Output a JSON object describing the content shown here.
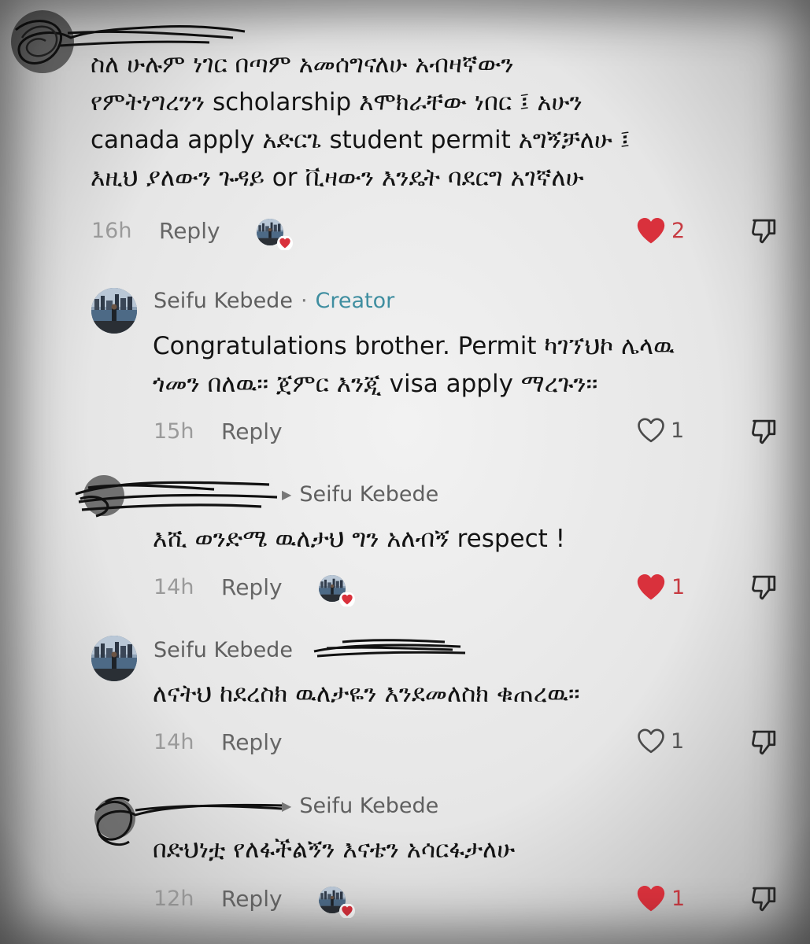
{
  "colors": {
    "liked_heart": "#d9313c",
    "creator": "#3f8ea0",
    "meta_gray": "#9a9a9a"
  },
  "comments": [
    {
      "lines": [
        "ስለ ሁሉም ነገር በጣም አመሰግናለሁ አብዛኛውን",
        "የምትነግረንን scholarship እሞክራቸው ነበር ፤ አሁን",
        "canada apply አድርጌ student permit አግኝቻለሁ ፤",
        "እዚህ ያለውን ጉዳይ or ቪዛውን እንዴት ባደርግ አገኛለሁ"
      ],
      "time": "16h",
      "reply": "Reply",
      "likes": "2",
      "liked": true,
      "creator_liked": true
    },
    {
      "author": "Seifu Kebede",
      "separator": "·",
      "badge": "Creator",
      "lines": [
        "Congratulations brother. Permit ካገኘህኮ ሌላዉ",
        "ጎመን በለዉ፡፡ ጀምር እንጂ visa apply ማረጉን፡፡"
      ],
      "time": "15h",
      "reply": "Reply",
      "likes": "1",
      "liked": false
    },
    {
      "reply_to": "Seifu Kebede",
      "lines": [
        "እሺ ወንድሜ ዉለታህ ግን አለብኝ respect !"
      ],
      "time": "14h",
      "reply": "Reply",
      "likes": "1",
      "liked": true,
      "creator_liked": true
    },
    {
      "author": "Seifu Kebede",
      "lines": [
        "ለናትህ ከደረስክ ዉለታዬን እንደመለስክ ቁጠረዉ፡፡"
      ],
      "time": "14h",
      "reply": "Reply",
      "likes": "1",
      "liked": false
    },
    {
      "reply_to": "Seifu Kebede",
      "lines": [
        "በድህነቷ የለፋችልኝን እናቴን አሳርፋታለሁ"
      ],
      "time": "12h",
      "reply": "Reply",
      "likes": "1",
      "liked": true,
      "creator_liked": true
    }
  ]
}
